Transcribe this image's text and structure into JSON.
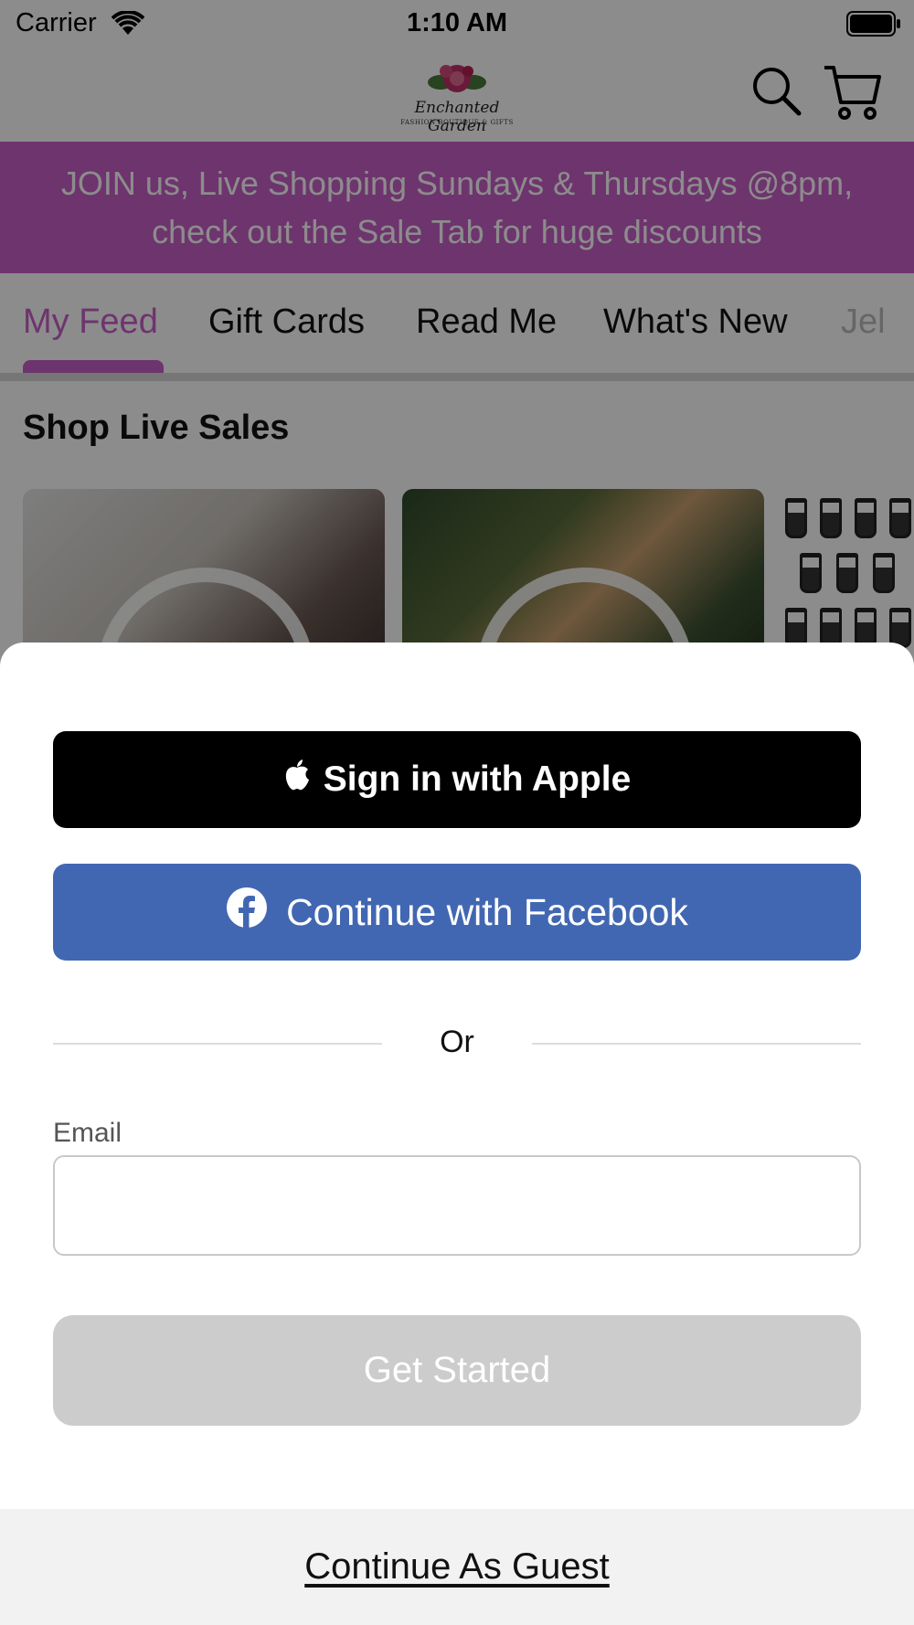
{
  "status_bar": {
    "carrier": "Carrier",
    "time": "1:10 AM"
  },
  "header": {
    "logo_text": "Enchanted Garden",
    "logo_subtext": "FASHION BOUTIQUE & GIFTS",
    "icons": [
      "search-icon",
      "cart-icon"
    ]
  },
  "banner": {
    "line1": "JOIN us, Live Shopping Sundays & Thursdays @8pm,",
    "line2": "check out the Sale Tab for huge discounts"
  },
  "tabs": [
    {
      "label": "My Feed",
      "active": true
    },
    {
      "label": "Gift Cards",
      "active": false
    },
    {
      "label": "Read Me",
      "active": false
    },
    {
      "label": "What's New",
      "active": false
    },
    {
      "label": "Jel",
      "active": false
    }
  ],
  "feed": {
    "section_title": "Shop Live Sales"
  },
  "login_sheet": {
    "apple_button": "Sign in with Apple",
    "facebook_button": "Continue with Facebook",
    "divider_text": "Or",
    "email_label": "Email",
    "email_value": "",
    "email_placeholder": "",
    "get_started_button": "Get Started",
    "guest_link": "Continue As Guest"
  },
  "colors": {
    "accent": "#c95fc9",
    "facebook": "#4267b2",
    "apple": "#000000",
    "disabled_button": "#cccccc"
  }
}
